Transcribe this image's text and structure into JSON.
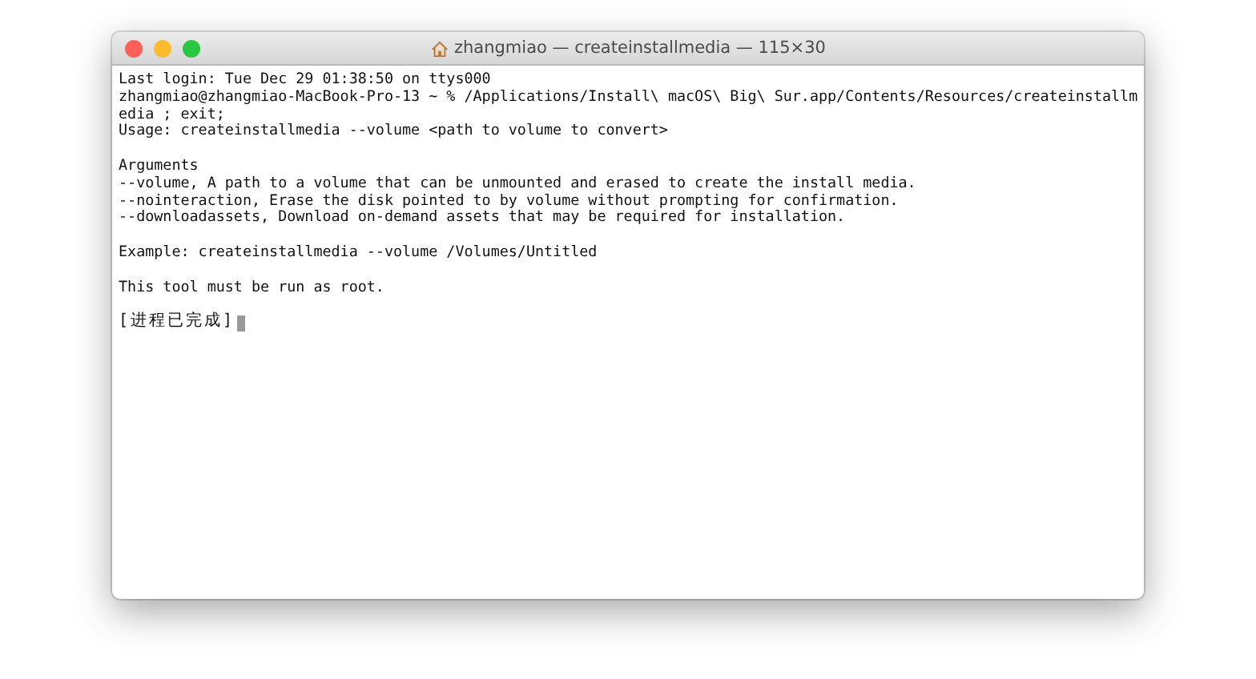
{
  "window": {
    "title": "zhangmiao — createinstallmedia — 115×30"
  },
  "terminal": {
    "blocks": [
      [
        "Last login: Tue Dec 29 01:38:50 on ttys000",
        "zhangmiao@zhangmiao-MacBook-Pro-13 ~ % /Applications/Install\\ macOS\\ Big\\ Sur.app/Contents/Resources/createinstallm",
        "edia ; exit;",
        "Usage: createinstallmedia --volume <path to volume to convert>"
      ],
      [
        "Arguments",
        "--volume, A path to a volume that can be unmounted and erased to create the install media.",
        "--nointeraction, Erase the disk pointed to by volume without prompting for confirmation.",
        "--downloadassets, Download on-demand assets that may be required for installation."
      ],
      [
        "Example: createinstallmedia --volume /Volumes/Untitled"
      ],
      [
        "This tool must be run as root."
      ]
    ],
    "final_line": "[进程已完成]"
  }
}
